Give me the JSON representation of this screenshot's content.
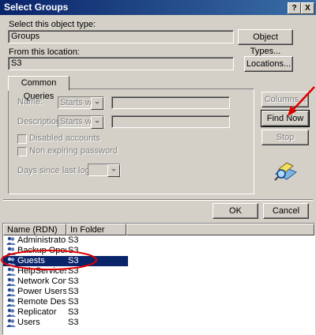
{
  "window": {
    "title": "Select Groups",
    "help_btn": "?",
    "close_btn": "X"
  },
  "object_type": {
    "label": "Select this object type:",
    "value": "Groups",
    "button": "Object Types..."
  },
  "location": {
    "label": "From this location:",
    "value": "S3",
    "button": "Locations..."
  },
  "queries": {
    "tab_label": "Common Queries",
    "name_label": "Name:",
    "name_mode": "Starts with",
    "description_label": "Description:",
    "description_mode": "Starts with",
    "disabled_label": "Disabled accounts",
    "nonexpiring_label": "Non expiring password",
    "days_label": "Days since last logon:"
  },
  "side_buttons": {
    "columns": "Columns...",
    "find_now": "Find Now",
    "stop": "Stop"
  },
  "dialog_buttons": {
    "ok": "OK",
    "cancel": "Cancel"
  },
  "results": {
    "columns": [
      "Name (RDN)",
      "In Folder"
    ],
    "rows": [
      {
        "name": "Administrators",
        "folder": "S3"
      },
      {
        "name": "Backup Oper...",
        "folder": "S3"
      },
      {
        "name": "Guests",
        "folder": "S3"
      },
      {
        "name": "HelpServices...",
        "folder": "S3"
      },
      {
        "name": "Network Confi...",
        "folder": "S3"
      },
      {
        "name": "Power Users",
        "folder": "S3"
      },
      {
        "name": "Remote Desk...",
        "folder": "S3"
      },
      {
        "name": "Replicator",
        "folder": "S3"
      },
      {
        "name": "Users",
        "folder": "S3"
      }
    ],
    "selected_index": 2
  },
  "colors": {
    "title_bar": "#0a246a",
    "selection": "#0a246a",
    "annotation": "#e00000"
  }
}
